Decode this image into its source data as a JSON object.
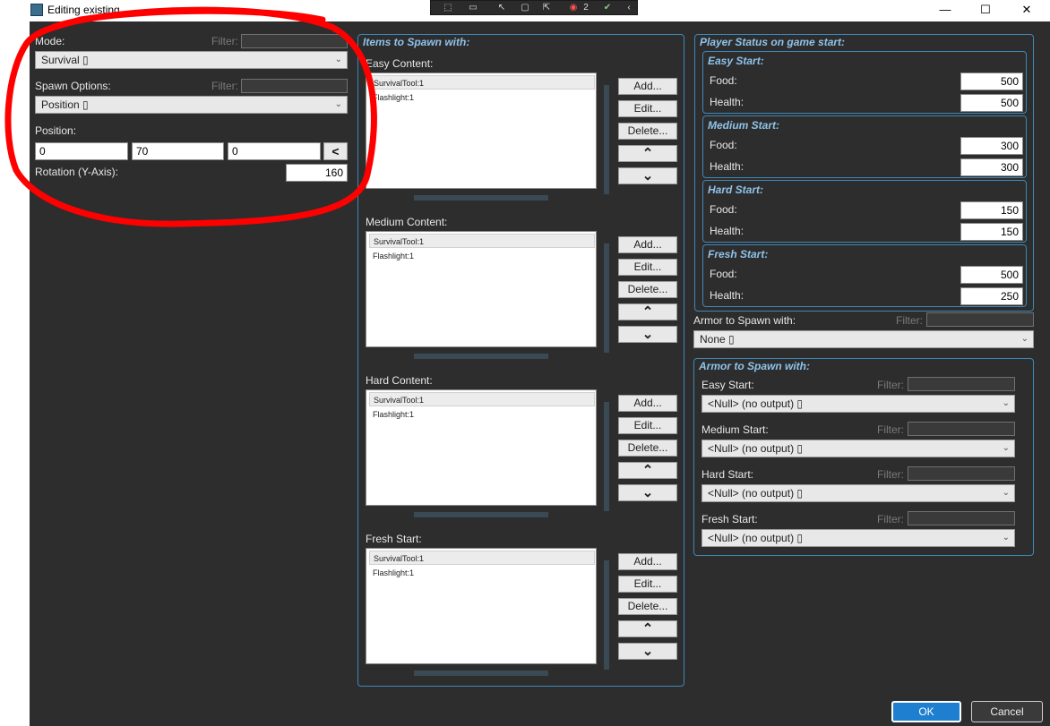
{
  "window": {
    "title": "Editing existing...",
    "minimize": "—",
    "maximize": "☐",
    "close": "✕"
  },
  "toolbar_float": {
    "icons": [
      "select-icon",
      "camera-icon",
      "pointer-icon",
      "frame-icon",
      "cursor-icon",
      "record-icon",
      "check-icon",
      "back-icon"
    ],
    "record_count": "2"
  },
  "left": {
    "mode_label": "Mode:",
    "mode_filter_label": "Filter:",
    "mode_value": "Survival ▯",
    "spawn_options_label": "Spawn Options:",
    "spawn_filter_label": "Filter:",
    "spawn_options_value": "Position ▯",
    "position_label": "Position:",
    "position": [
      "0",
      "70",
      "0"
    ],
    "rotation_label": "Rotation (Y-Axis):",
    "rotation_value": "160"
  },
  "items": {
    "title": "Items to Spawn with:",
    "buttons": {
      "add": "Add...",
      "edit": "Edit...",
      "delete": "Delete...",
      "up": "^",
      "down": "v"
    },
    "sections": [
      {
        "label": "Easy Content:",
        "items": [
          "SurvivalTool:1",
          "Flashlight:1"
        ]
      },
      {
        "label": "Medium Content:",
        "items": [
          "SurvivalTool:1",
          "Flashlight:1"
        ]
      },
      {
        "label": "Hard Content:",
        "items": [
          "SurvivalTool:1",
          "Flashlight:1"
        ]
      },
      {
        "label": "Fresh Start:",
        "items": [
          "SurvivalTool:1",
          "Flashlight:1"
        ]
      }
    ]
  },
  "status": {
    "title": "Player Status on game start:",
    "groups": [
      {
        "title": "Easy Start:",
        "food_label": "Food:",
        "food": "500",
        "health_label": "Health:",
        "health": "500"
      },
      {
        "title": "Medium Start:",
        "food_label": "Food:",
        "food": "300",
        "health_label": "Health:",
        "health": "300"
      },
      {
        "title": "Hard Start:",
        "food_label": "Food:",
        "food": "150",
        "health_label": "Health:",
        "health": "150"
      },
      {
        "title": "Fresh Start:",
        "food_label": "Food:",
        "food": "500",
        "health_label": "Health:",
        "health": "250"
      }
    ]
  },
  "armor_single": {
    "label": "Armor to Spawn with:",
    "filter_label": "Filter:",
    "value": "None ▯"
  },
  "armor_group": {
    "title": "Armor to Spawn with:",
    "rows": [
      {
        "label": "Easy Start:",
        "filter_label": "Filter:",
        "value": "<Null> (no output) ▯"
      },
      {
        "label": "Medium Start:",
        "filter_label": "Filter:",
        "value": "<Null> (no output) ▯"
      },
      {
        "label": "Hard Start:",
        "filter_label": "Filter:",
        "value": "<Null> (no output) ▯"
      },
      {
        "label": "Fresh Start:",
        "filter_label": "Filter:",
        "value": "<Null> (no output) ▯"
      }
    ]
  },
  "footer": {
    "ok": "OK",
    "cancel": "Cancel"
  },
  "colors": {
    "dialog_bg": "#2d2d2d",
    "accent": "#3f88b8",
    "group_title": "#8fc3ea",
    "ok_button": "#1e7fd0",
    "annotation": "#ff0000"
  }
}
